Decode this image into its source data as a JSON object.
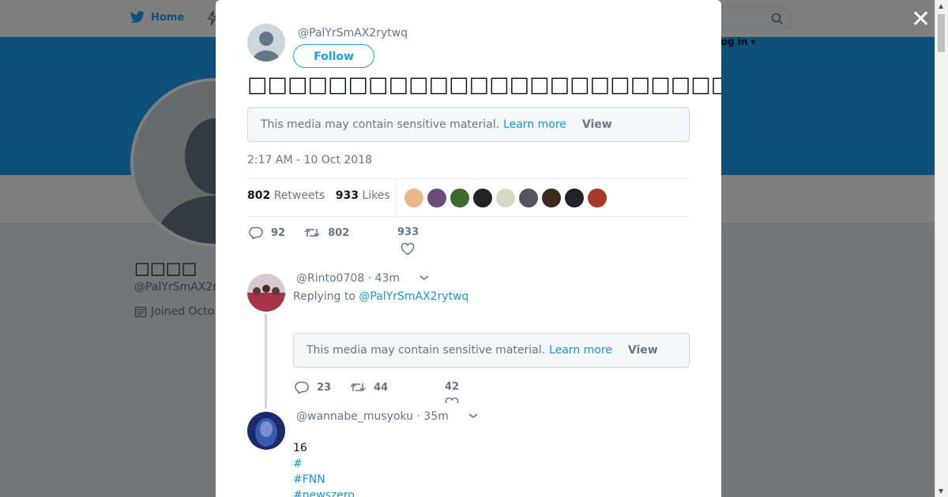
{
  "page": {
    "nav_home_label": "Home",
    "login_label": "Log in ▾",
    "profile_name": "□□□□",
    "profile_handle": "@PalYrSmAX2r",
    "profile_joined": "Joined Octo"
  },
  "tweet": {
    "handle": "@PalYrSmAX2rytwq",
    "follow_label": "Follow",
    "text": "□□□□□□□□□□□□□□□□□□□□□□□□□□□□□□□□□□□□□□□",
    "sensitive_text": "This media may contain sensitive material.",
    "learn_more": "Learn more",
    "view_label": "View",
    "timestamp": "2:17 AM - 10 Oct 2018",
    "retweets_count": "802",
    "retweets_label": "Retweets",
    "likes_count": "933",
    "likes_label": "Likes",
    "likers_colors": [
      "#e8b98a",
      "#6b4a7a",
      "#3d6b2e",
      "#222222",
      "#d8d8c8",
      "#555560",
      "#3b2a20",
      "#202028",
      "#a83a2a"
    ],
    "actions": {
      "replies": "92",
      "retweets": "802",
      "likes": "933"
    }
  },
  "replies": [
    {
      "handle": "@Rinto0708",
      "time": "· 43m",
      "replying_to_label": "Replying to",
      "replying_to_handle": "@PalYrSmAX2rytwq",
      "sensitive_text": "This media may contain sensitive material.",
      "learn_more": "Learn more",
      "view_label": "View",
      "actions": {
        "replies": "23",
        "retweets": "44",
        "likes": "42"
      }
    },
    {
      "handle": "@wannabe_musyoku",
      "time": "· 35m",
      "text": "16",
      "hashtags": [
        "#",
        "#FNN",
        "#newszero"
      ]
    }
  ]
}
